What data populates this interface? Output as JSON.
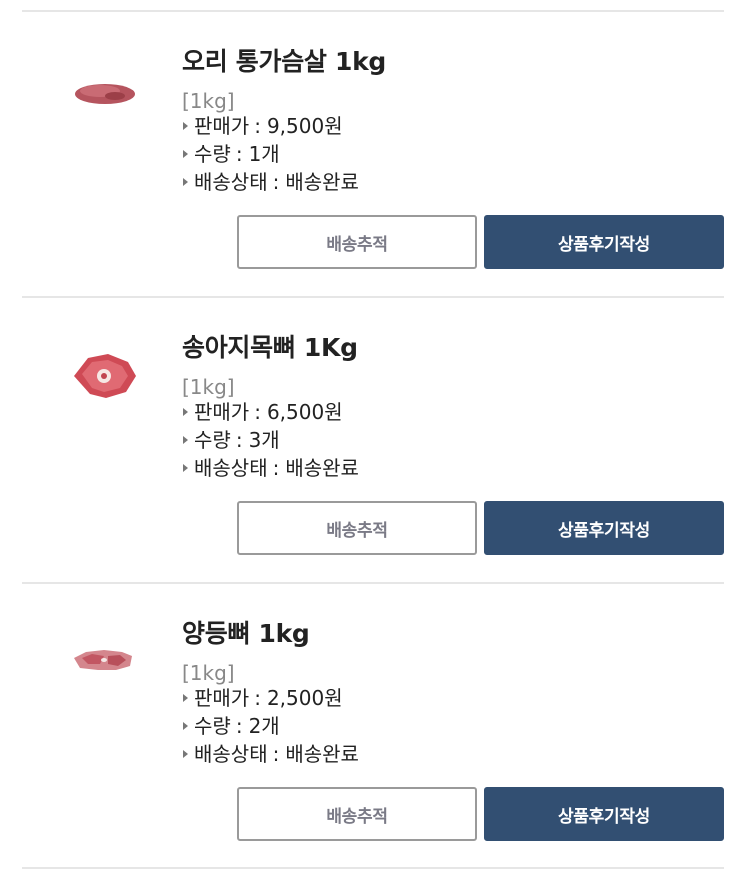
{
  "labels": {
    "price": "판매가",
    "quantity": "수량",
    "status": "배송상태",
    "separator": ":"
  },
  "items": [
    {
      "name": "오리 통가슴살 1kg",
      "option": "[1kg]",
      "price": "9,500원",
      "quantity": "1개",
      "status": "배송완료",
      "track_button": "배송추적",
      "review_button": "상품후기작성",
      "thumbnail": "duck-breast-meat-image"
    },
    {
      "name": "송아지목뼈 1Kg",
      "option": "[1kg]",
      "price": "6,500원",
      "quantity": "3개",
      "status": "배송완료",
      "track_button": "배송추적",
      "review_button": "상품후기작성",
      "thumbnail": "veal-neck-bone-image"
    },
    {
      "name": "양등뼈 1kg",
      "option": "[1kg]",
      "price": "2,500원",
      "quantity": "2개",
      "status": "배송완료",
      "track_button": "배송추적",
      "review_button": "상품후기작성",
      "thumbnail": "lamb-back-bone-image"
    }
  ],
  "colors": {
    "primary_button": "#324f72",
    "divider": "#e6e6e6",
    "option_text": "#888888"
  }
}
